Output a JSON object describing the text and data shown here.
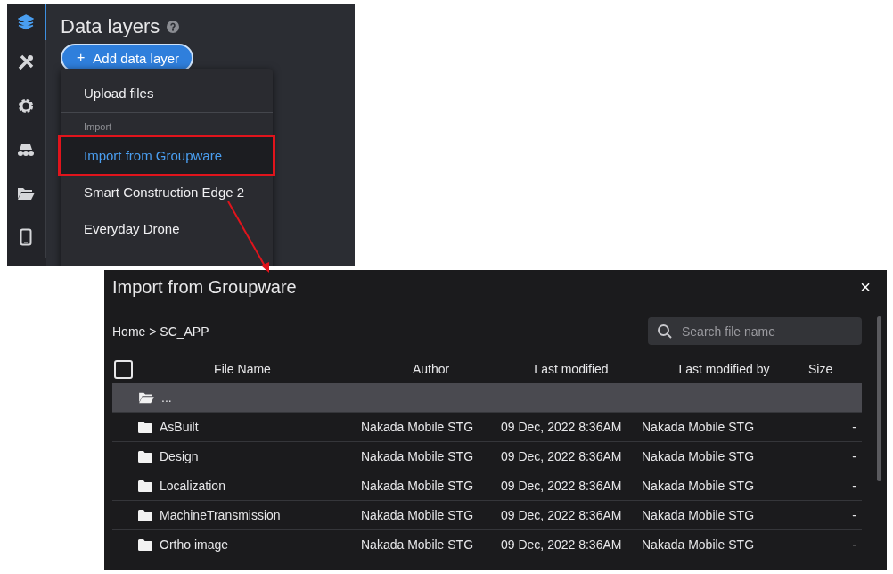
{
  "sidebar": {
    "items": [
      {
        "kind": "layers",
        "selected": true
      },
      {
        "kind": "tools",
        "selected": false
      },
      {
        "kind": "settings",
        "selected": false
      },
      {
        "kind": "vehicle",
        "selected": false
      },
      {
        "kind": "folder",
        "selected": false
      },
      {
        "kind": "device",
        "selected": false
      }
    ]
  },
  "panel": {
    "title": "Data layers",
    "add_button": {
      "icon": "+",
      "label": "Add data layer"
    }
  },
  "menu": {
    "items": [
      {
        "kind": "item",
        "label": "Upload files",
        "selected": false,
        "annotated": false
      },
      {
        "kind": "section",
        "label": "Import"
      },
      {
        "kind": "item",
        "label": "Import from Groupware",
        "selected": true,
        "annotated": true
      },
      {
        "kind": "item",
        "label": "Smart Construction Edge 2",
        "selected": false,
        "annotated": false
      },
      {
        "kind": "item",
        "label": "Everyday Drone",
        "selected": false,
        "annotated": false
      }
    ]
  },
  "dialog": {
    "title": "Import from Groupware",
    "close": "×",
    "breadcrumb": "Home > SC_APP",
    "search": {
      "placeholder": "Search file name"
    },
    "table": {
      "select_all_checked": false,
      "columns": [
        "File Name",
        "Author",
        "Last modified",
        "Last modified by",
        "Size"
      ],
      "rows": [
        {
          "kind": "parent",
          "name": "...",
          "selected": true
        },
        {
          "kind": "folder",
          "name": "AsBuilt",
          "author": "Nakada Mobile STG",
          "modified": "09 Dec, 2022 8:36AM",
          "modified_by": "Nakada Mobile STG",
          "size": "-",
          "selected": false
        },
        {
          "kind": "folder",
          "name": "Design",
          "author": "Nakada Mobile STG",
          "modified": "09 Dec, 2022 8:36AM",
          "modified_by": "Nakada Mobile STG",
          "size": "-",
          "selected": false
        },
        {
          "kind": "folder",
          "name": "Localization",
          "author": "Nakada Mobile STG",
          "modified": "09 Dec, 2022 8:36AM",
          "modified_by": "Nakada Mobile STG",
          "size": "-",
          "selected": false
        },
        {
          "kind": "folder",
          "name": "MachineTransmission",
          "author": "Nakada Mobile STG",
          "modified": "09 Dec, 2022 8:36AM",
          "modified_by": "Nakada Mobile STG",
          "size": "-",
          "selected": false
        },
        {
          "kind": "folder",
          "name": "Ortho image",
          "author": "Nakada Mobile STG",
          "modified": "09 Dec, 2022 8:36AM",
          "modified_by": "Nakada Mobile STG",
          "size": "-",
          "selected": false
        }
      ]
    }
  }
}
